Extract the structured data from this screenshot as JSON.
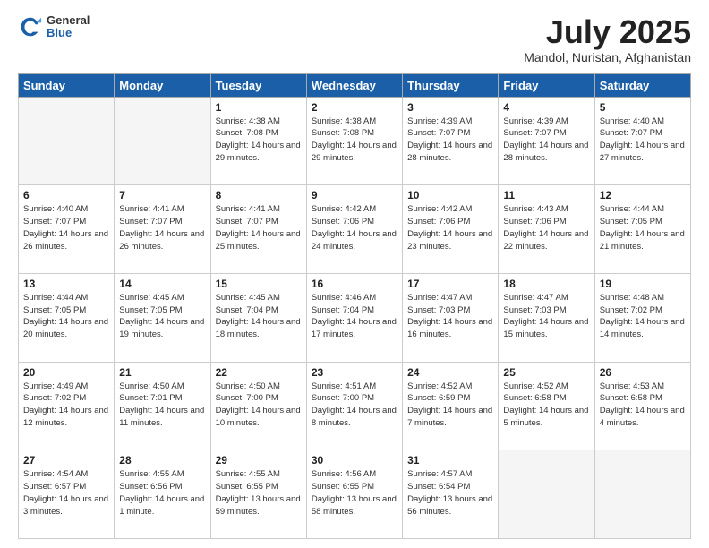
{
  "header": {
    "logo_general": "General",
    "logo_blue": "Blue",
    "title": "July 2025",
    "location": "Mandol, Nuristan, Afghanistan"
  },
  "weekdays": [
    "Sunday",
    "Monday",
    "Tuesday",
    "Wednesday",
    "Thursday",
    "Friday",
    "Saturday"
  ],
  "weeks": [
    [
      {
        "day": "",
        "sunrise": "",
        "sunset": "",
        "daylight": "",
        "empty": true
      },
      {
        "day": "",
        "sunrise": "",
        "sunset": "",
        "daylight": "",
        "empty": true
      },
      {
        "day": "1",
        "sunrise": "Sunrise: 4:38 AM",
        "sunset": "Sunset: 7:08 PM",
        "daylight": "Daylight: 14 hours and 29 minutes.",
        "empty": false
      },
      {
        "day": "2",
        "sunrise": "Sunrise: 4:38 AM",
        "sunset": "Sunset: 7:08 PM",
        "daylight": "Daylight: 14 hours and 29 minutes.",
        "empty": false
      },
      {
        "day": "3",
        "sunrise": "Sunrise: 4:39 AM",
        "sunset": "Sunset: 7:07 PM",
        "daylight": "Daylight: 14 hours and 28 minutes.",
        "empty": false
      },
      {
        "day": "4",
        "sunrise": "Sunrise: 4:39 AM",
        "sunset": "Sunset: 7:07 PM",
        "daylight": "Daylight: 14 hours and 28 minutes.",
        "empty": false
      },
      {
        "day": "5",
        "sunrise": "Sunrise: 4:40 AM",
        "sunset": "Sunset: 7:07 PM",
        "daylight": "Daylight: 14 hours and 27 minutes.",
        "empty": false
      }
    ],
    [
      {
        "day": "6",
        "sunrise": "Sunrise: 4:40 AM",
        "sunset": "Sunset: 7:07 PM",
        "daylight": "Daylight: 14 hours and 26 minutes.",
        "empty": false
      },
      {
        "day": "7",
        "sunrise": "Sunrise: 4:41 AM",
        "sunset": "Sunset: 7:07 PM",
        "daylight": "Daylight: 14 hours and 26 minutes.",
        "empty": false
      },
      {
        "day": "8",
        "sunrise": "Sunrise: 4:41 AM",
        "sunset": "Sunset: 7:07 PM",
        "daylight": "Daylight: 14 hours and 25 minutes.",
        "empty": false
      },
      {
        "day": "9",
        "sunrise": "Sunrise: 4:42 AM",
        "sunset": "Sunset: 7:06 PM",
        "daylight": "Daylight: 14 hours and 24 minutes.",
        "empty": false
      },
      {
        "day": "10",
        "sunrise": "Sunrise: 4:42 AM",
        "sunset": "Sunset: 7:06 PM",
        "daylight": "Daylight: 14 hours and 23 minutes.",
        "empty": false
      },
      {
        "day": "11",
        "sunrise": "Sunrise: 4:43 AM",
        "sunset": "Sunset: 7:06 PM",
        "daylight": "Daylight: 14 hours and 22 minutes.",
        "empty": false
      },
      {
        "day": "12",
        "sunrise": "Sunrise: 4:44 AM",
        "sunset": "Sunset: 7:05 PM",
        "daylight": "Daylight: 14 hours and 21 minutes.",
        "empty": false
      }
    ],
    [
      {
        "day": "13",
        "sunrise": "Sunrise: 4:44 AM",
        "sunset": "Sunset: 7:05 PM",
        "daylight": "Daylight: 14 hours and 20 minutes.",
        "empty": false
      },
      {
        "day": "14",
        "sunrise": "Sunrise: 4:45 AM",
        "sunset": "Sunset: 7:05 PM",
        "daylight": "Daylight: 14 hours and 19 minutes.",
        "empty": false
      },
      {
        "day": "15",
        "sunrise": "Sunrise: 4:45 AM",
        "sunset": "Sunset: 7:04 PM",
        "daylight": "Daylight: 14 hours and 18 minutes.",
        "empty": false
      },
      {
        "day": "16",
        "sunrise": "Sunrise: 4:46 AM",
        "sunset": "Sunset: 7:04 PM",
        "daylight": "Daylight: 14 hours and 17 minutes.",
        "empty": false
      },
      {
        "day": "17",
        "sunrise": "Sunrise: 4:47 AM",
        "sunset": "Sunset: 7:03 PM",
        "daylight": "Daylight: 14 hours and 16 minutes.",
        "empty": false
      },
      {
        "day": "18",
        "sunrise": "Sunrise: 4:47 AM",
        "sunset": "Sunset: 7:03 PM",
        "daylight": "Daylight: 14 hours and 15 minutes.",
        "empty": false
      },
      {
        "day": "19",
        "sunrise": "Sunrise: 4:48 AM",
        "sunset": "Sunset: 7:02 PM",
        "daylight": "Daylight: 14 hours and 14 minutes.",
        "empty": false
      }
    ],
    [
      {
        "day": "20",
        "sunrise": "Sunrise: 4:49 AM",
        "sunset": "Sunset: 7:02 PM",
        "daylight": "Daylight: 14 hours and 12 minutes.",
        "empty": false
      },
      {
        "day": "21",
        "sunrise": "Sunrise: 4:50 AM",
        "sunset": "Sunset: 7:01 PM",
        "daylight": "Daylight: 14 hours and 11 minutes.",
        "empty": false
      },
      {
        "day": "22",
        "sunrise": "Sunrise: 4:50 AM",
        "sunset": "Sunset: 7:00 PM",
        "daylight": "Daylight: 14 hours and 10 minutes.",
        "empty": false
      },
      {
        "day": "23",
        "sunrise": "Sunrise: 4:51 AM",
        "sunset": "Sunset: 7:00 PM",
        "daylight": "Daylight: 14 hours and 8 minutes.",
        "empty": false
      },
      {
        "day": "24",
        "sunrise": "Sunrise: 4:52 AM",
        "sunset": "Sunset: 6:59 PM",
        "daylight": "Daylight: 14 hours and 7 minutes.",
        "empty": false
      },
      {
        "day": "25",
        "sunrise": "Sunrise: 4:52 AM",
        "sunset": "Sunset: 6:58 PM",
        "daylight": "Daylight: 14 hours and 5 minutes.",
        "empty": false
      },
      {
        "day": "26",
        "sunrise": "Sunrise: 4:53 AM",
        "sunset": "Sunset: 6:58 PM",
        "daylight": "Daylight: 14 hours and 4 minutes.",
        "empty": false
      }
    ],
    [
      {
        "day": "27",
        "sunrise": "Sunrise: 4:54 AM",
        "sunset": "Sunset: 6:57 PM",
        "daylight": "Daylight: 14 hours and 3 minutes.",
        "empty": false
      },
      {
        "day": "28",
        "sunrise": "Sunrise: 4:55 AM",
        "sunset": "Sunset: 6:56 PM",
        "daylight": "Daylight: 14 hours and 1 minute.",
        "empty": false
      },
      {
        "day": "29",
        "sunrise": "Sunrise: 4:55 AM",
        "sunset": "Sunset: 6:55 PM",
        "daylight": "Daylight: 13 hours and 59 minutes.",
        "empty": false
      },
      {
        "day": "30",
        "sunrise": "Sunrise: 4:56 AM",
        "sunset": "Sunset: 6:55 PM",
        "daylight": "Daylight: 13 hours and 58 minutes.",
        "empty": false
      },
      {
        "day": "31",
        "sunrise": "Sunrise: 4:57 AM",
        "sunset": "Sunset: 6:54 PM",
        "daylight": "Daylight: 13 hours and 56 minutes.",
        "empty": false
      },
      {
        "day": "",
        "sunrise": "",
        "sunset": "",
        "daylight": "",
        "empty": true
      },
      {
        "day": "",
        "sunrise": "",
        "sunset": "",
        "daylight": "",
        "empty": true
      }
    ]
  ]
}
